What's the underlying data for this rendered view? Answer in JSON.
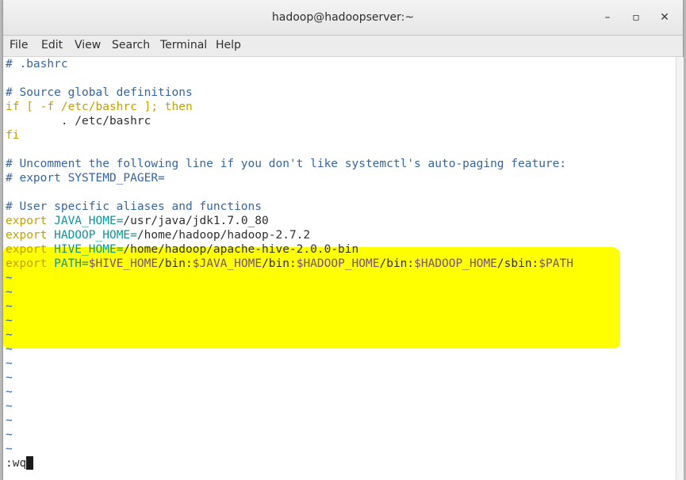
{
  "window": {
    "title": "hadoop@hadoopserver:~",
    "minimize_icon": "–",
    "maximize_icon": "▫",
    "close_icon": "✕"
  },
  "menu": [
    "File",
    "Edit",
    "View",
    "Search",
    "Terminal",
    "Help"
  ],
  "colors": {
    "comment": "#3465a4",
    "keyword": "#c4a000",
    "variable": "#06989a",
    "path_var": "#75507b",
    "highlight": "#ffff00"
  },
  "terminal": {
    "l1": "# .bashrc",
    "l3": "# Source global definitions",
    "l4_kw1": "if",
    "l4_mid": " [ -f /etc/bashrc ]; ",
    "l4_kw2": "then",
    "l5": "        . /etc/bashrc",
    "l6": "fi",
    "l8": "# Uncomment the following line if you don't like systemctl's auto-paging feature:",
    "l9": "# export SYSTEMD_PAGER=",
    "l11": "# User specific aliases and functions",
    "l12_kw": "export",
    "l12_var": " JAVA_HOME=",
    "l12_val": "/usr/java/jdk1.7.0_80",
    "l13_kw": "export",
    "l13_var": " HADOOP_HOME=",
    "l13_val": "/home/hadoop/hadoop-2.7.2",
    "l14_kw": "export",
    "l14_var": " HIVE_HOME=",
    "l14_val": "/home/hadoop/apache-hive-2.0.0-bin",
    "l15_kw": "export",
    "l15_var": " PATH=",
    "l15_p1": "$HIVE_HOME",
    "l15_s1": "/bin:",
    "l15_p2": "$JAVA_HOME",
    "l15_s2": "/bin:",
    "l15_p3": "$HADOOP_HOME",
    "l15_s3": "/bin:",
    "l15_p4": "$HADOOP_HOME",
    "l15_s4": "/sbin:",
    "l15_p5": "$PATH",
    "tilde": "~",
    "command": ":wq"
  }
}
